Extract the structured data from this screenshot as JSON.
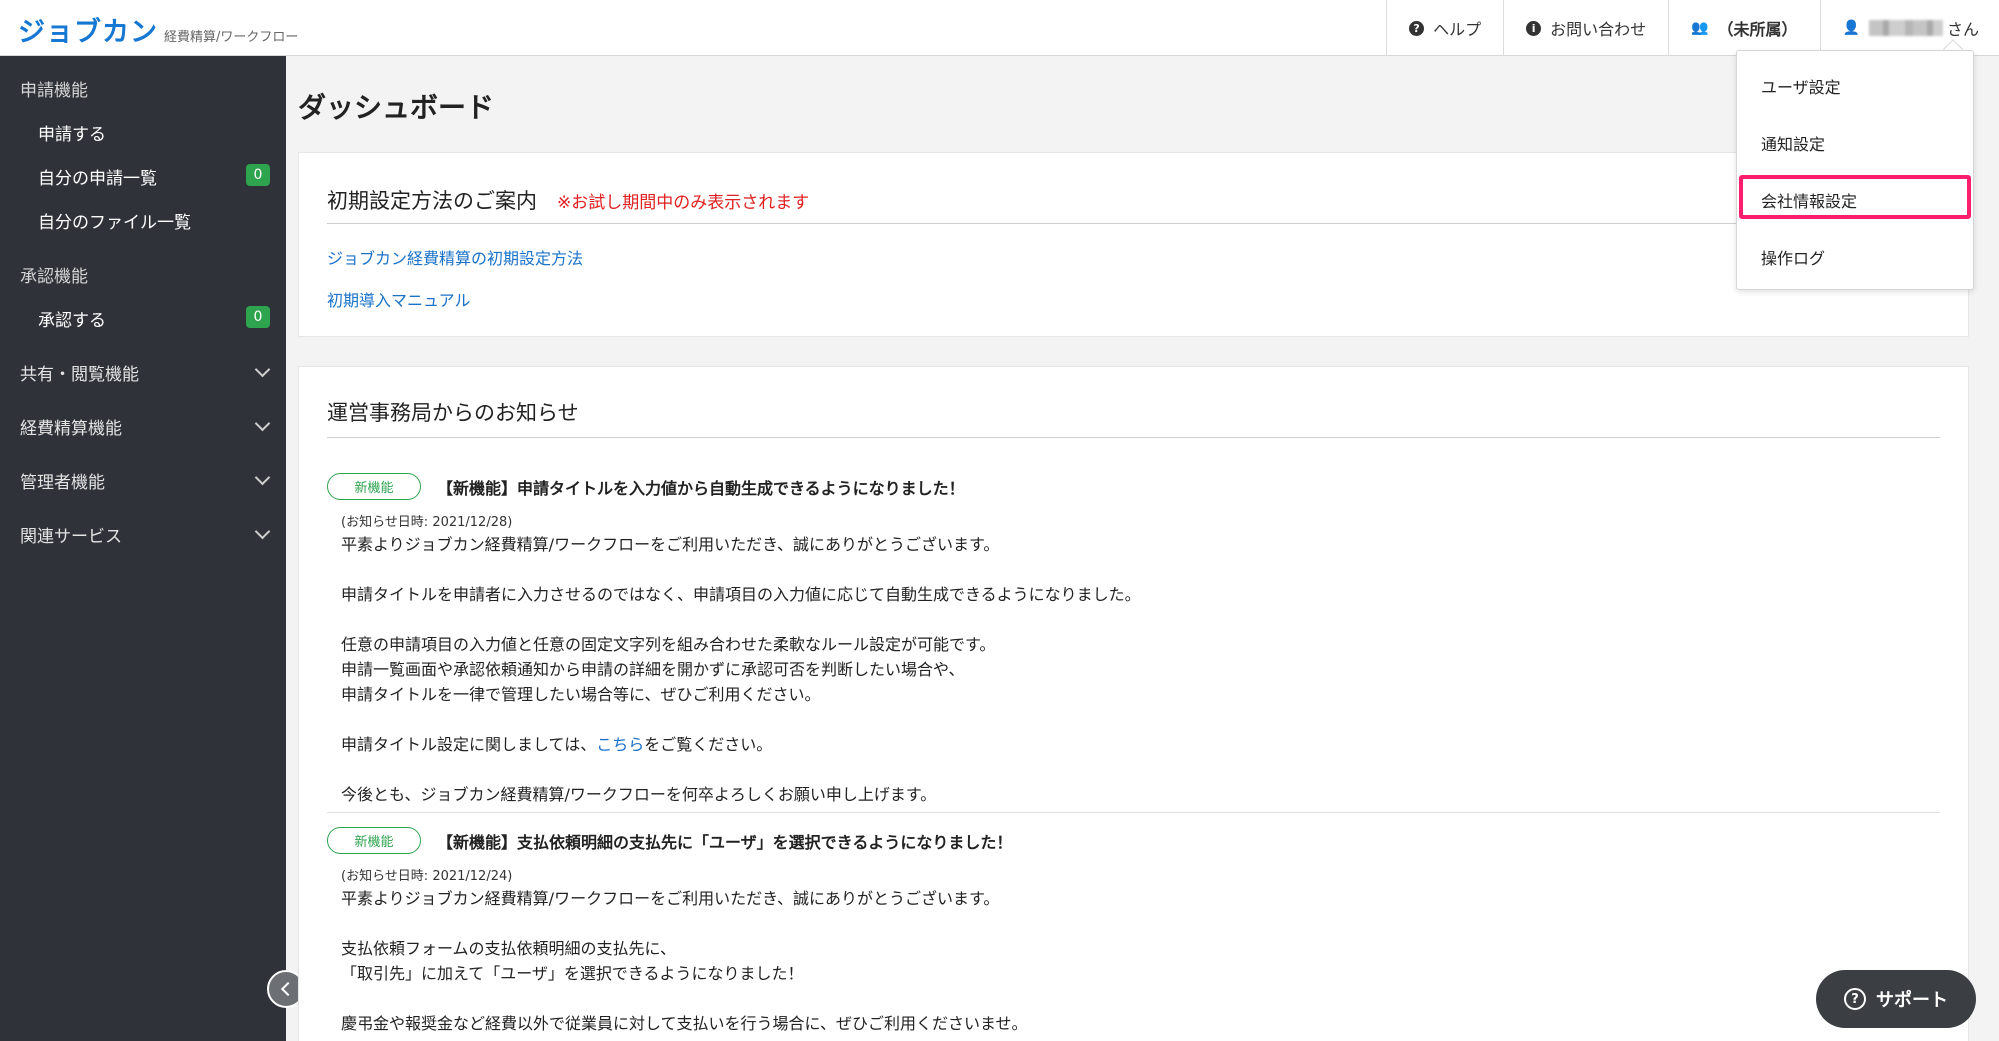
{
  "header": {
    "logo": "ジョブカン",
    "logo_sub": "経費精算/ワークフロー",
    "help": "ヘルプ",
    "contact": "お問い合わせ",
    "group": "（未所属）",
    "user_suffix": "さん"
  },
  "sidebar": {
    "apply_section": "申請機能",
    "apply": "申請する",
    "my_applications": "自分の申請一覧",
    "my_applications_count": "0",
    "my_files": "自分のファイル一覧",
    "approve_section": "承認機能",
    "approve": "承認する",
    "approve_count": "0",
    "share": "共有・閲覧機能",
    "expense": "経費精算機能",
    "admin": "管理者機能",
    "related": "関連サービス"
  },
  "page_title": "ダッシュボード",
  "setup": {
    "title": "初期設定方法のご案内",
    "note": "※お試し期間中のみ表示されます",
    "link1": "ジョブカン経費精算の初期設定方法",
    "link2": "初期導入マニュアル"
  },
  "news": {
    "title": "運営事務局からのお知らせ",
    "items": [
      {
        "tag": "新機能",
        "title": "【新機能】申請タイトルを入力値から自動生成できるようになりました！",
        "date": "(お知らせ日時: 2021/12/28)",
        "l1": "平素よりジョブカン経費精算/ワークフローをご利用いただき、誠にありがとうございます。",
        "l2": "申請タイトルを申請者に入力させるのではなく、申請項目の入力値に応じて自動生成できるようになりました。",
        "l3": "任意の申請項目の入力値と任意の固定文字列を組み合わせた柔軟なルール設定が可能です。",
        "l4": "申請一覧画面や承認依頼通知から申請の詳細を開かずに承認可否を判断したい場合や、",
        "l5": "申請タイトルを一律で管理したい場合等に、ぜひご利用ください。",
        "l6_pre": "申請タイトル設定に関しましては、",
        "l6_link": "こちら",
        "l6_post": "をご覧ください。",
        "l7": "今後とも、ジョブカン経費精算/ワークフローを何卒よろしくお願い申し上げます。"
      },
      {
        "tag": "新機能",
        "title": "【新機能】支払依頼明細の支払先に「ユーザ」を選択できるようになりました！",
        "date": "(お知らせ日時: 2021/12/24)",
        "l1": "平素よりジョブカン経費精算/ワークフローをご利用いただき、誠にありがとうございます。",
        "l2": "支払依頼フォームの支払依頼明細の支払先に、",
        "l3": "「取引先」に加えて「ユーザ」を選択できるようになりました！",
        "l4": "慶弔金や報奨金など経費以外で従業員に対して支払いを行う場合に、ぜひご利用くださいませ。"
      }
    ]
  },
  "dropdown": {
    "user_settings": "ユーザ設定",
    "notification_settings": "通知設定",
    "company_settings": "会社情報設定",
    "operation_log": "操作ログ"
  },
  "support": "サポート"
}
